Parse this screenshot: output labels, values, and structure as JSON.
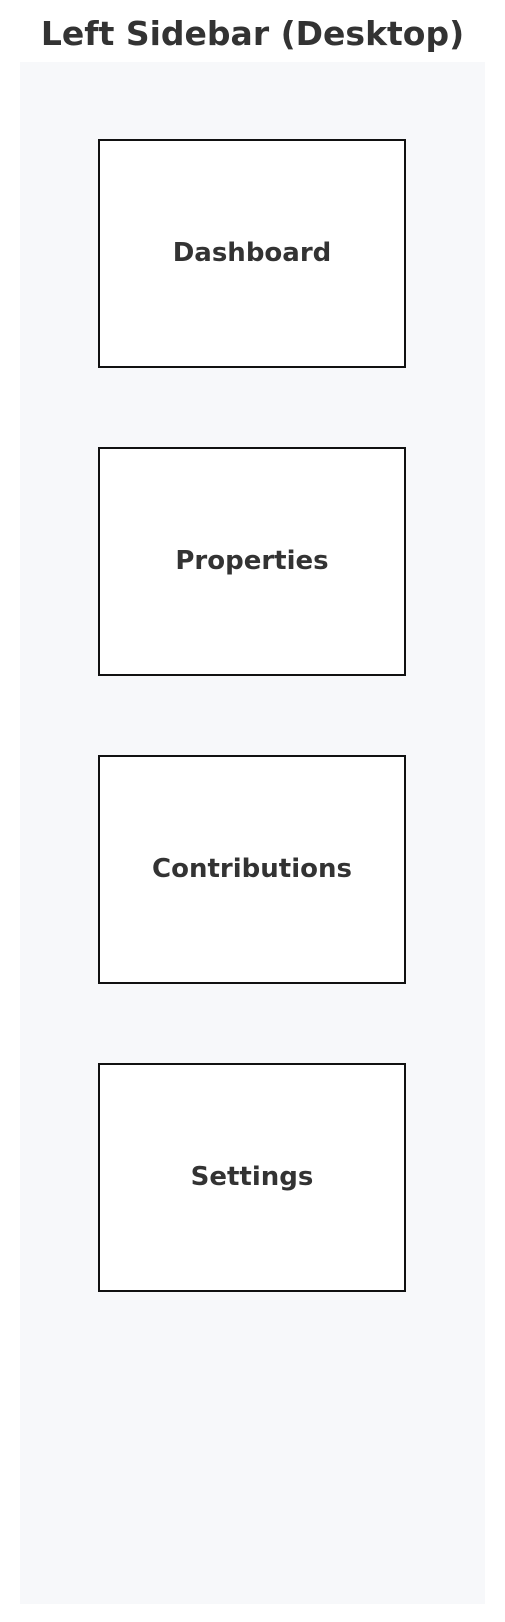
{
  "title": "Left Sidebar (Desktop)",
  "sidebar": {
    "items": [
      {
        "label": "Dashboard"
      },
      {
        "label": "Properties"
      },
      {
        "label": "Contributions"
      },
      {
        "label": "Settings"
      }
    ]
  },
  "colors": {
    "text": "#333333",
    "sidebar_background": "#f7f8fa",
    "item_border": "#111111",
    "item_background": "#ffffff"
  }
}
